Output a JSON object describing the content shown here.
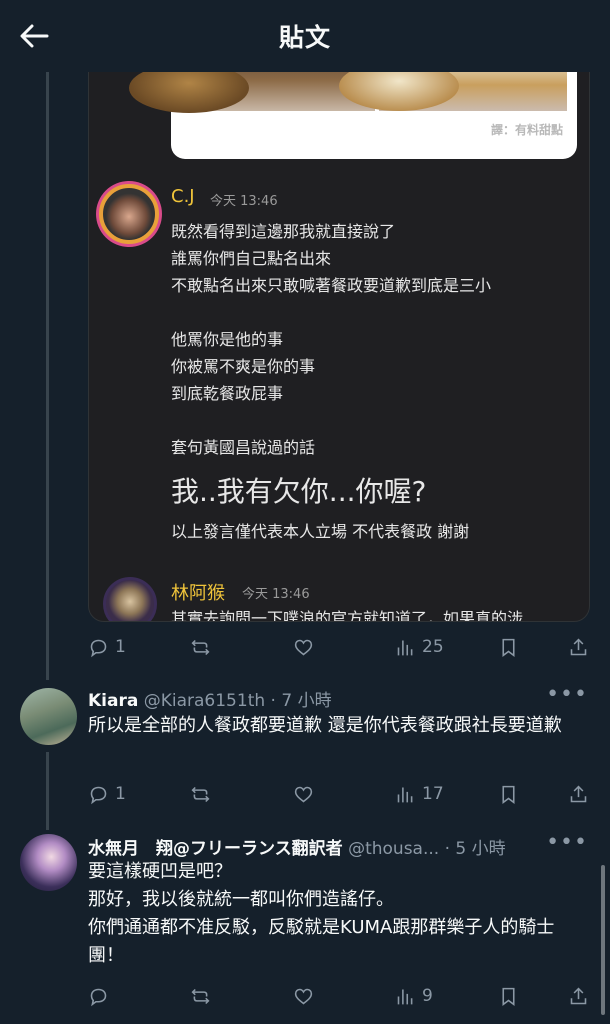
{
  "header": {
    "title": "貼文"
  },
  "media": {
    "watermark": "譯：有料甜點",
    "comments": [
      {
        "name": "C.J",
        "time": "今天 13:46",
        "lines": "既然看得到這邊那我就直接說了\n誰罵你們自己點名出來\n不敢點名出來只敢喊著餐政要道歉到底是三小\n\n他罵你是他的事\n你被罵不爽是你的事\n到底乾餐政屁事\n\n套句黃國昌說過的話",
        "big": "我..我有欠你...你喔?",
        "note": "以上發言僅代表本人立場 不代表餐政 謝謝"
      },
      {
        "name": "林阿猴",
        "time": "今天 13:46",
        "lines": "其實去詢問一下噗浪的官方就知道了，如果真的涉"
      }
    ]
  },
  "main_actions": {
    "reply": "1",
    "retweet": "",
    "like": "",
    "views": "25"
  },
  "tweets": [
    {
      "name": "Kiara",
      "handle": "@Kiara6151th · 7 小時",
      "text": "所以是全部的人餐政都要道歉 還是你代表餐政跟社長要道歉",
      "actions": {
        "reply": "1",
        "retweet": "",
        "like": "",
        "views": "17"
      }
    },
    {
      "name": "水無月　翔@フリーランス翻訳者",
      "handle": "@thousa... · 5 小時",
      "text": "要這樣硬凹是吧？\n那好，我以後就統一都叫你們造謠仔。\n你們通通都不准反駁，反駁就是KUMA跟那群樂子人的騎士團！",
      "actions": {
        "reply": "",
        "retweet": "",
        "like": "",
        "views": "9"
      }
    }
  ],
  "icons": {
    "back": "arrow-left-icon",
    "reply": "reply-icon",
    "retweet": "retweet-icon",
    "like": "heart-icon",
    "views": "views-icon",
    "bookmark": "bookmark-icon",
    "share": "share-icon",
    "more": "more-icon"
  },
  "colors": {
    "background": "#15202b",
    "muted": "#8b98a5",
    "name_yellow": "#f0c43a"
  }
}
